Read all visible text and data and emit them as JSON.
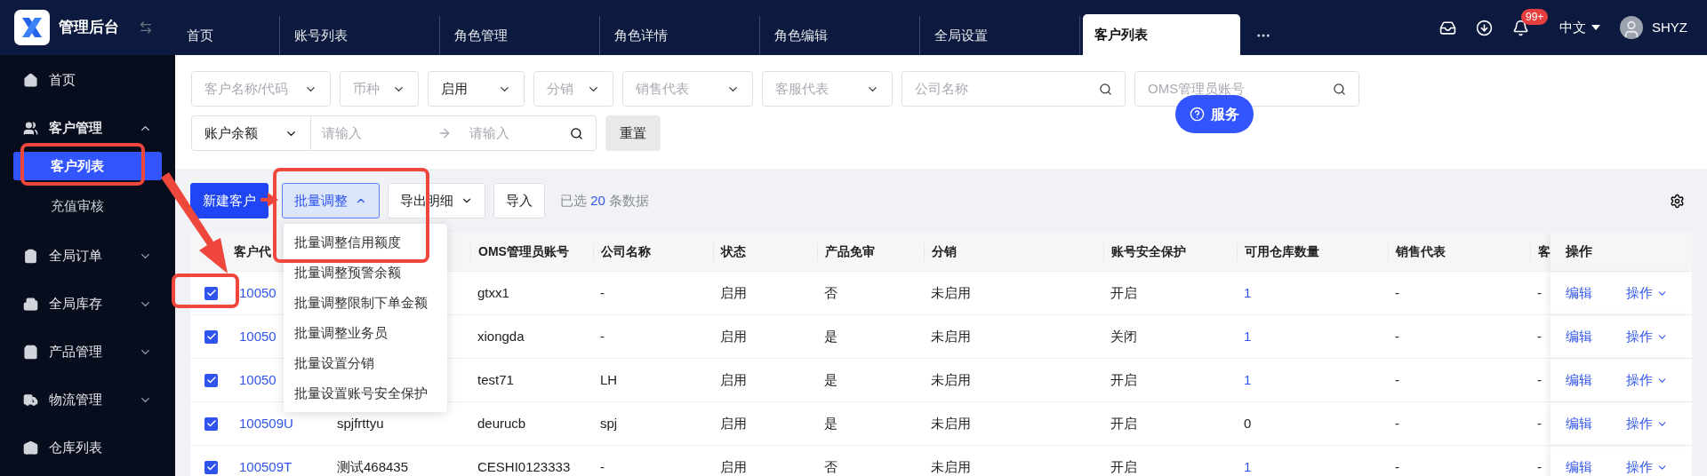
{
  "app": {
    "title": "管理后台"
  },
  "tabs": [
    {
      "label": "首页",
      "selected": false
    },
    {
      "label": "账号列表",
      "selected": false
    },
    {
      "label": "角色管理",
      "selected": false
    },
    {
      "label": "角色详情",
      "selected": false
    },
    {
      "label": "角色编辑",
      "selected": false
    },
    {
      "label": "全局设置",
      "selected": false
    },
    {
      "label": "客户列表",
      "selected": true
    }
  ],
  "header": {
    "notification_badge": "99+",
    "language": "中文",
    "user": "SHYZ"
  },
  "sidebar": {
    "items": [
      {
        "label": "首页"
      },
      {
        "label": "客户管理",
        "expanded": true,
        "children": [
          {
            "label": "客户列表",
            "selected": true
          },
          {
            "label": "充值审核",
            "selected": false
          }
        ]
      },
      {
        "label": "全局订单",
        "expanded": false
      },
      {
        "label": "全局库存",
        "expanded": false
      },
      {
        "label": "产品管理",
        "expanded": false
      },
      {
        "label": "物流管理",
        "expanded": false
      },
      {
        "label": "仓库列表"
      }
    ]
  },
  "filters": {
    "fields": [
      {
        "kind": "select",
        "placeholder": "客户名称/代码"
      },
      {
        "kind": "select",
        "placeholder": "币种"
      },
      {
        "kind": "select",
        "value": "启用"
      },
      {
        "kind": "select",
        "placeholder": "分销"
      },
      {
        "kind": "select",
        "placeholder": "销售代表"
      },
      {
        "kind": "select",
        "placeholder": "客服代表"
      },
      {
        "kind": "search",
        "placeholder": "公司名称"
      },
      {
        "kind": "search",
        "placeholder": "OMS管理员账号"
      }
    ],
    "balance": {
      "field": "账户余额",
      "from_placeholder": "请输入",
      "to_placeholder": "请输入"
    },
    "reset_button": "重置"
  },
  "service_button": "服务",
  "toolbar": {
    "buttons": [
      {
        "label": "新建客户",
        "kind": "primary"
      },
      {
        "label": "批量调整",
        "kind": "dropdown",
        "expanded": true
      },
      {
        "label": "导出明细",
        "kind": "dropdown",
        "expanded": false
      },
      {
        "label": "导入",
        "kind": "plain"
      }
    ],
    "selection_prefix": "已选",
    "selection_count": "20",
    "selection_suffix": "条数据"
  },
  "batch_menu": [
    "批量调整信用额度",
    "批量调整预警余额",
    "批量调整限制下单金额",
    "批量调整业务员",
    "批量设置分销",
    "批量设置账号安全保护"
  ],
  "table": {
    "columns": [
      "客户代",
      "OMS管理员账号",
      "公司名称",
      "状态",
      "产品免审",
      "分销",
      "账号安全保护",
      "可用仓库数量",
      "销售代表",
      "客"
    ],
    "actions_label": "操作",
    "rows": [
      {
        "selected": true,
        "code": "10050",
        "oms_account": "gtxx1",
        "company": "-",
        "status": "启用",
        "product_exempt": "否",
        "distribution": "未启用",
        "security": "开启",
        "warehouse_count": "1",
        "warehouse_link": true,
        "sales_rep": "-",
        "column_12": "-",
        "actions": [
          "编辑",
          "操作"
        ]
      },
      {
        "selected": true,
        "code": "10050",
        "oms_account": "xiongda",
        "company": "-",
        "status": "启用",
        "product_exempt": "是",
        "distribution": "未启用",
        "security": "关闭",
        "warehouse_count": "1",
        "warehouse_link": true,
        "sales_rep": "-",
        "column_12": "-",
        "actions": [
          "编辑",
          "操作"
        ]
      },
      {
        "selected": true,
        "code": "10050",
        "oms_account": "test71",
        "company": "LH",
        "status": "启用",
        "product_exempt": "是",
        "distribution": "未启用",
        "security": "开启",
        "warehouse_count": "1",
        "warehouse_link": true,
        "sales_rep": "-",
        "column_12": "-",
        "actions": [
          "编辑",
          "操作"
        ]
      },
      {
        "selected": true,
        "code": "100509U",
        "column_2": "spjfrttyu",
        "oms_account": "deurucb",
        "company": "spj",
        "status": "启用",
        "product_exempt": "是",
        "distribution": "未启用",
        "security": "开启",
        "warehouse_count": "0",
        "warehouse_link": false,
        "sales_rep": "-",
        "column_12": "-",
        "actions": [
          "编辑",
          "操作"
        ]
      },
      {
        "selected": true,
        "code": "100509T",
        "column_2": "测试468435",
        "oms_account": "CESHI0123333",
        "company": "-",
        "status": "启用",
        "product_exempt": "否",
        "distribution": "未启用",
        "security": "开启",
        "warehouse_count": "1",
        "warehouse_link": true,
        "sales_rep": "-",
        "column_12": "-",
        "actions": [
          "编辑",
          "操作"
        ]
      }
    ]
  }
}
